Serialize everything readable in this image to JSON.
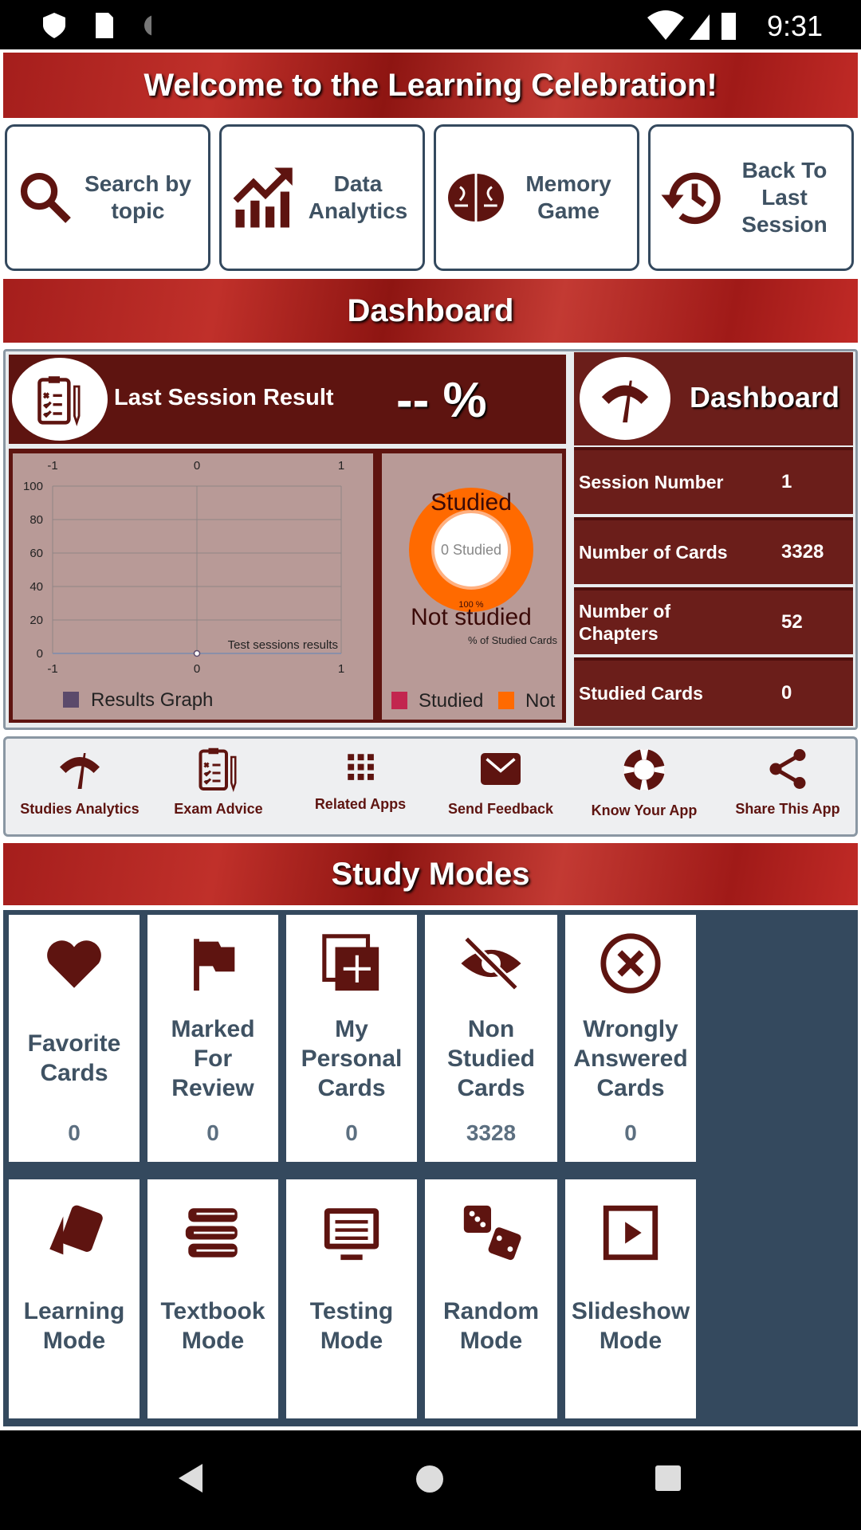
{
  "status_bar": {
    "time": "9:31"
  },
  "welcome_banner": "Welcome to the Learning Celebration!",
  "quick_actions": [
    {
      "label": "Search by topic",
      "icon": "search-icon"
    },
    {
      "label": "Data Analytics",
      "icon": "trending-up-chart-icon"
    },
    {
      "label": "Memory Game",
      "icon": "brain-icon"
    },
    {
      "label": "Back To Last Session",
      "icon": "history-icon"
    }
  ],
  "dashboard_banner": "Dashboard",
  "last_session": {
    "title": "Last Session Result",
    "value": "-- %"
  },
  "dashboard_card": {
    "title": "Dashboard",
    "stats": [
      {
        "label": "Session Number",
        "value": "1"
      },
      {
        "label": "Number of Cards",
        "value": "3328"
      },
      {
        "label": "Number of Chapters",
        "value": "52"
      },
      {
        "label": "Studied Cards",
        "value": "0"
      }
    ]
  },
  "chart_data": [
    {
      "type": "line",
      "description": "Test sessions results",
      "xlim": [
        -1,
        1
      ],
      "ylim": [
        0,
        100
      ],
      "x_ticks": [
        "-1",
        "0",
        "1"
      ],
      "y_ticks": [
        "0",
        "20",
        "40",
        "60",
        "80",
        "100"
      ],
      "grid": true,
      "legend": "bottom-left",
      "series": [
        {
          "name": "Results Graph",
          "color": "#5b4a6b",
          "points": [
            {
              "x": 0,
              "y": 0
            }
          ]
        }
      ]
    },
    {
      "type": "pie",
      "description": "% of Studied Cards",
      "center_text": "0 Studied",
      "slice_labels": [
        "Studied",
        "Not studied"
      ],
      "percent_label": "100 %",
      "legend": "bottom",
      "slices": [
        {
          "name": "Studied",
          "value": 0,
          "color": "#c2264f"
        },
        {
          "name": "Not",
          "value": 100,
          "color": "#ff6a00"
        }
      ]
    }
  ],
  "action_bar": [
    {
      "label": "Studies Analytics",
      "icon": "gauge-icon"
    },
    {
      "label": "Exam Advice",
      "icon": "clipboard-checklist-icon"
    },
    {
      "label": "Related Apps",
      "icon": "grid-icon"
    },
    {
      "label": "Send Feedback",
      "icon": "mail-icon"
    },
    {
      "label": "Know Your App",
      "icon": "lifebuoy-icon"
    },
    {
      "label": "Share This App",
      "icon": "share-icon"
    }
  ],
  "study_modes_banner": "Study Modes",
  "study_modes_row1": [
    {
      "label": "Favorite Cards",
      "count": "0",
      "icon": "heart-icon"
    },
    {
      "label": "Marked For Review",
      "count": "0",
      "icon": "flag-icon"
    },
    {
      "label": "My Personal Cards",
      "count": "0",
      "icon": "add-card-icon"
    },
    {
      "label": "Non Studied Cards",
      "count": "3328",
      "icon": "eye-off-icon"
    },
    {
      "label": "Wrongly Answered Cards",
      "count": "0",
      "icon": "x-circle-icon"
    }
  ],
  "study_modes_row2": [
    {
      "label": "Learning Mode",
      "icon": "cards-icon"
    },
    {
      "label": "Textbook Mode",
      "icon": "books-icon"
    },
    {
      "label": "Testing Mode",
      "icon": "monitor-icon"
    },
    {
      "label": "Random Mode",
      "icon": "dice-icon"
    },
    {
      "label": "Slideshow Mode",
      "icon": "play-icon"
    }
  ],
  "colors": {
    "primary": "#5e1410",
    "text": "#3f5263",
    "donut": "#ff6a00"
  }
}
